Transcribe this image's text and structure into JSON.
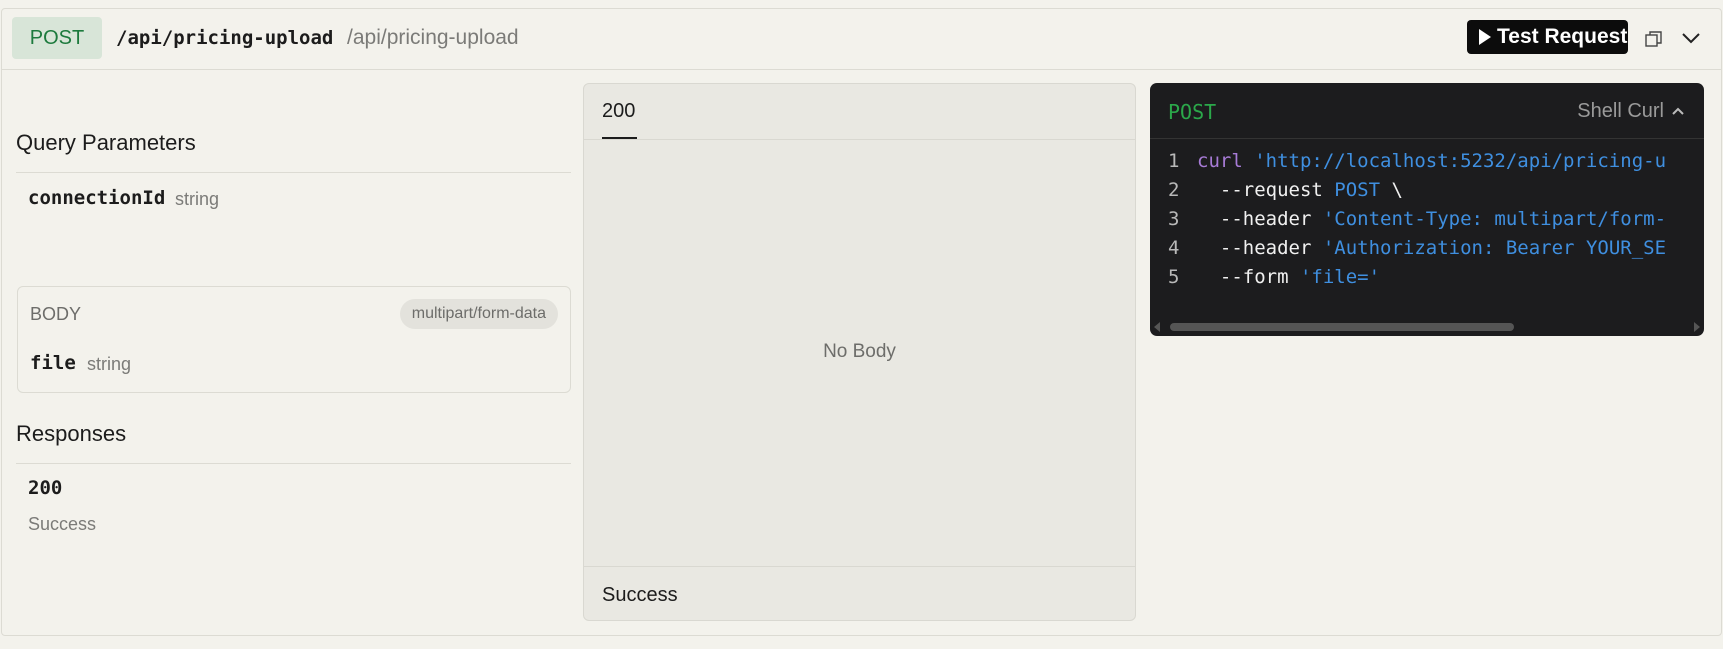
{
  "header": {
    "method": "POST",
    "path_bold": "/api/pricing-upload",
    "path_light": "/api/pricing-upload",
    "test_request_label": "Test Request"
  },
  "query_parameters": {
    "title": "Query Parameters",
    "params": [
      {
        "name": "connectionId",
        "type": "string"
      }
    ]
  },
  "body": {
    "label": "BODY",
    "content_type": "multipart/form-data",
    "fields": [
      {
        "name": "file",
        "type": "string"
      }
    ]
  },
  "responses": {
    "title": "Responses",
    "items": [
      {
        "code": "200",
        "description": "Success"
      }
    ]
  },
  "response_panel": {
    "tab": "200",
    "empty_text": "No Body",
    "footer": "Success"
  },
  "code_sample": {
    "method": "POST",
    "language": "Shell Curl",
    "lines": [
      {
        "num": "1",
        "parts": [
          {
            "t": "kw",
            "s": "curl "
          },
          {
            "t": "str",
            "s": "'http://localhost:5232/api/pricing-u"
          }
        ]
      },
      {
        "num": "2",
        "parts": [
          {
            "t": "flag",
            "s": "  --request "
          },
          {
            "t": "str",
            "s": "POST "
          },
          {
            "t": "plain",
            "s": "\\"
          }
        ]
      },
      {
        "num": "3",
        "parts": [
          {
            "t": "flag",
            "s": "  --header "
          },
          {
            "t": "str",
            "s": "'Content-Type: multipart/form-"
          }
        ]
      },
      {
        "num": "4",
        "parts": [
          {
            "t": "flag",
            "s": "  --header "
          },
          {
            "t": "str",
            "s": "'Authorization: Bearer YOUR_SE"
          }
        ]
      },
      {
        "num": "5",
        "parts": [
          {
            "t": "flag",
            "s": "  --form "
          },
          {
            "t": "str",
            "s": "'file='"
          }
        ]
      }
    ]
  },
  "colors": {
    "post_green": "#1d7a3d",
    "code_bg": "#1c1c1e",
    "string_blue": "#3f8fe0",
    "keyword_purple": "#a77bd6"
  }
}
